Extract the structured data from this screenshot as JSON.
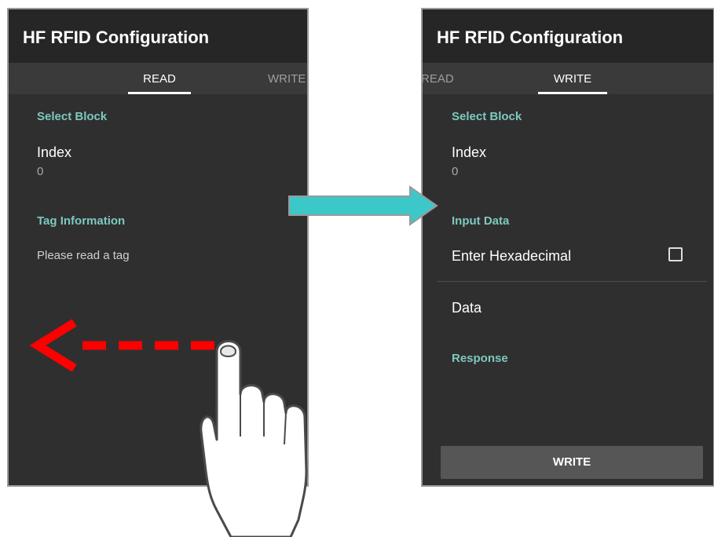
{
  "app": {
    "title": "HF RFID Configuration"
  },
  "left_screen": {
    "tabs": [
      {
        "label": "READ",
        "active": true
      },
      {
        "label": "WRITE",
        "active": false
      }
    ],
    "select_block_header": "Select Block",
    "index_label": "Index",
    "index_value": "0",
    "tag_info_header": "Tag Information",
    "tag_info_text": "Please read a tag"
  },
  "right_screen": {
    "tabs": [
      {
        "label": "READ",
        "active": false
      },
      {
        "label": "WRITE",
        "active": true
      }
    ],
    "select_block_header": "Select Block",
    "index_label": "Index",
    "index_value": "0",
    "input_data_header": "Input Data",
    "enter_hex_label": "Enter Hexadecimal",
    "enter_hex_checked": false,
    "data_label": "Data",
    "response_header": "Response",
    "write_button_label": "WRITE"
  },
  "colors": {
    "accent_teal": "#7ec8c0",
    "transition_arrow": "#3cc8c8",
    "swipe_arrow": "#ff0000"
  },
  "icons": [
    "checkbox-icon",
    "swipe-left-arrow-icon",
    "hand-pointer-icon",
    "transition-arrow-icon"
  ]
}
